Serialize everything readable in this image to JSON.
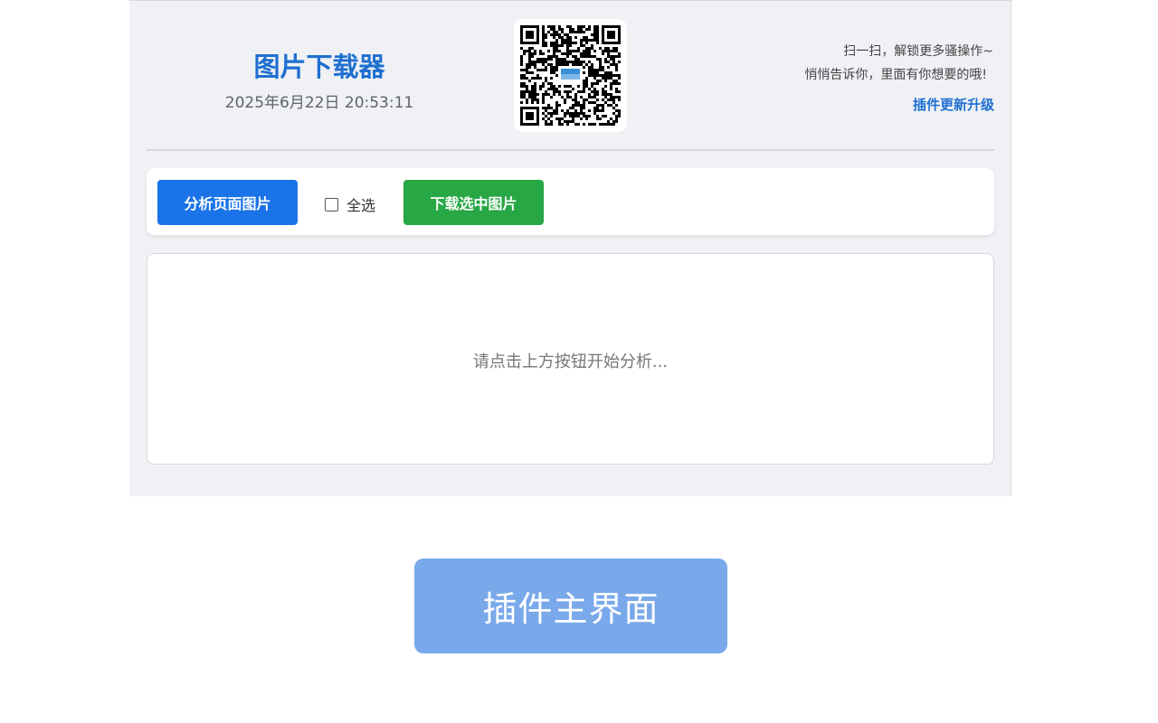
{
  "header": {
    "title": "图片下载器",
    "datetime": "2025年6月22日 20:53:11",
    "promo_line1": "扫一扫，解锁更多骚操作~",
    "promo_line2": "悄悄告诉你，里面有你想要的哦!",
    "update_link": "插件更新升级",
    "qr_icon": "qr-code-icon"
  },
  "toolbar": {
    "analyze_label": "分析页面图片",
    "select_all_label": "全选",
    "select_all_checked": false,
    "download_label": "下载选中图片"
  },
  "result": {
    "placeholder": "请点击上方按钮开始分析..."
  },
  "caption": {
    "text": "插件主界面"
  },
  "colors": {
    "accent": "#1a73e8",
    "download": "#28a745",
    "title": "#1f6fd1",
    "caption_bg": "#79a9ea"
  }
}
